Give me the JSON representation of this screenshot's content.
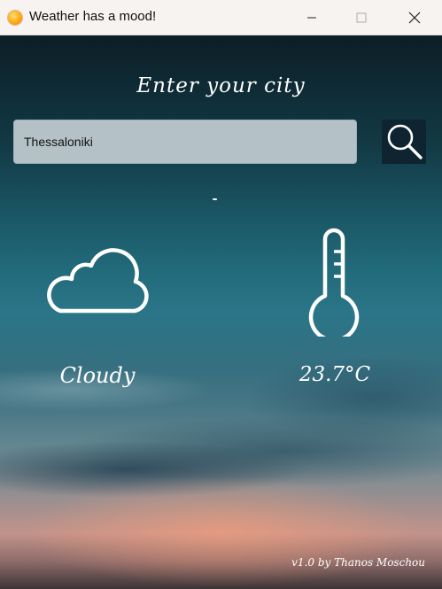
{
  "window": {
    "title": "Weather has a mood!",
    "icon": "sun-icon"
  },
  "header": {
    "prompt": "Enter your city"
  },
  "search": {
    "value": "Thessaloniki",
    "button_icon": "magnifier-icon"
  },
  "weather": {
    "condition": "Cloudy",
    "condition_icon": "cloud-icon",
    "temperature": "23.7°C",
    "temperature_icon": "thermometer-icon"
  },
  "footer": {
    "version": "v1.0 by Thanos Moschou"
  },
  "colors": {
    "titlebar": "#f7f3f1",
    "input_bg": "#b4c2c8",
    "search_button_bg": "#0e2430",
    "text_light": "#ffffff"
  }
}
